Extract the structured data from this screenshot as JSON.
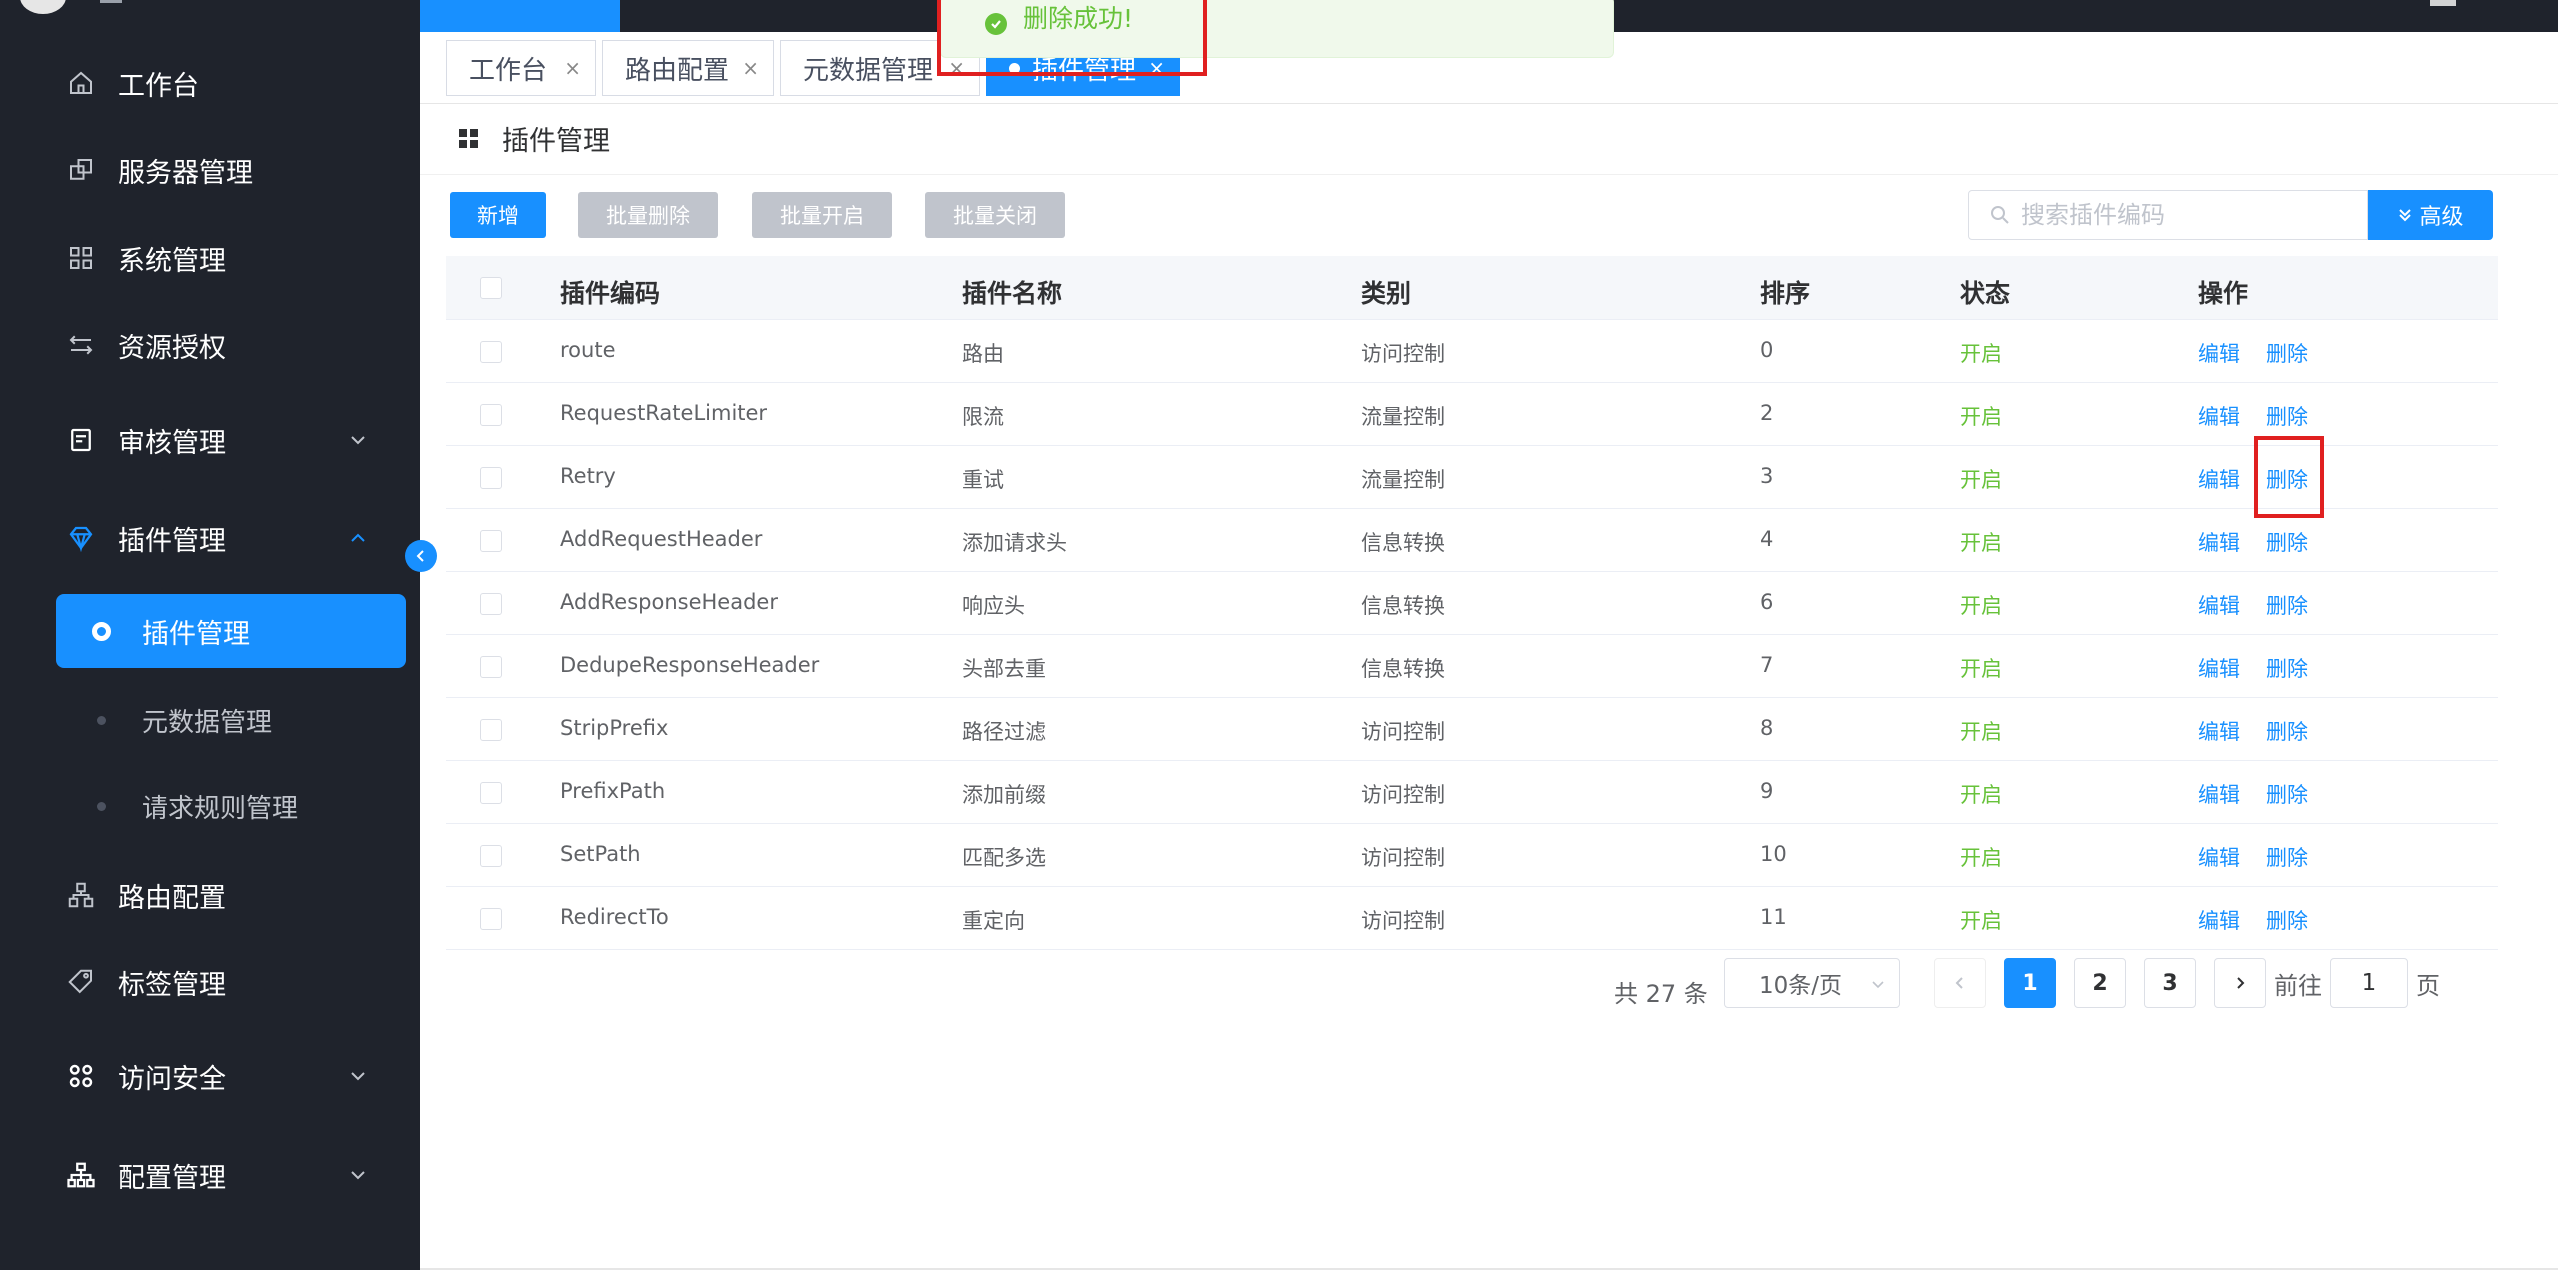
{
  "sidebar": {
    "items": [
      {
        "label": "工作台",
        "icon": "home-icon"
      },
      {
        "label": "服务器管理",
        "icon": "server-icon"
      },
      {
        "label": "系统管理",
        "icon": "grid-icon"
      },
      {
        "label": "资源授权",
        "icon": "transfer-icon"
      },
      {
        "label": "审核管理",
        "icon": "audit-icon"
      },
      {
        "label": "插件管理",
        "icon": "diamond-icon"
      },
      {
        "label": "路由配置",
        "icon": "network-icon"
      },
      {
        "label": "标签管理",
        "icon": "tag-icon"
      },
      {
        "label": "访问安全",
        "icon": "apps-icon"
      },
      {
        "label": "配置管理",
        "icon": "org-icon"
      }
    ],
    "subitems": [
      {
        "label": "插件管理",
        "active": true
      },
      {
        "label": "元数据管理",
        "active": false
      },
      {
        "label": "请求规则管理",
        "active": false
      }
    ]
  },
  "tags": [
    {
      "label": "工作台",
      "active": false
    },
    {
      "label": "路由配置",
      "active": false
    },
    {
      "label": "元数据管理",
      "active": false
    },
    {
      "label": "插件管理",
      "active": true
    }
  ],
  "toast": {
    "message": "删除成功!"
  },
  "page": {
    "title": "插件管理"
  },
  "toolbar": {
    "add": "新增",
    "batch_delete": "批量删除",
    "batch_enable": "批量开启",
    "batch_disable": "批量关闭",
    "search_placeholder": "搜索插件编码",
    "advanced": "高级"
  },
  "table": {
    "headers": [
      "插件编码",
      "插件名称",
      "类别",
      "排序",
      "状态",
      "操作"
    ],
    "rows": [
      {
        "code": "route",
        "name": "路由",
        "category": "访问控制",
        "sort": "0",
        "status": "开启"
      },
      {
        "code": "RequestRateLimiter",
        "name": "限流",
        "category": "流量控制",
        "sort": "2",
        "status": "开启"
      },
      {
        "code": "Retry",
        "name": "重试",
        "category": "流量控制",
        "sort": "3",
        "status": "开启"
      },
      {
        "code": "AddRequestHeader",
        "name": "添加请求头",
        "category": "信息转换",
        "sort": "4",
        "status": "开启"
      },
      {
        "code": "AddResponseHeader",
        "name": "响应头",
        "category": "信息转换",
        "sort": "6",
        "status": "开启"
      },
      {
        "code": "DedupeResponseHeader",
        "name": "头部去重",
        "category": "信息转换",
        "sort": "7",
        "status": "开启"
      },
      {
        "code": "StripPrefix",
        "name": "路径过滤",
        "category": "访问控制",
        "sort": "8",
        "status": "开启"
      },
      {
        "code": "PrefixPath",
        "name": "添加前缀",
        "category": "访问控制",
        "sort": "9",
        "status": "开启"
      },
      {
        "code": "SetPath",
        "name": "匹配多选",
        "category": "访问控制",
        "sort": "10",
        "status": "开启"
      },
      {
        "code": "RedirectTo",
        "name": "重定向",
        "category": "访问控制",
        "sort": "11",
        "status": "开启"
      }
    ],
    "edit_label": "编辑",
    "delete_label": "删除"
  },
  "pagination": {
    "total": "共 27 条",
    "page_size": "10条/页",
    "pages": [
      "1",
      "2",
      "3"
    ],
    "current": "1",
    "goto_label": "前往",
    "goto_value": "1",
    "page_suffix": "页"
  },
  "colors": {
    "primary": "#1890ff",
    "sidebar_bg": "#1f232c",
    "success": "#67c23a",
    "highlight": "#e02020"
  }
}
